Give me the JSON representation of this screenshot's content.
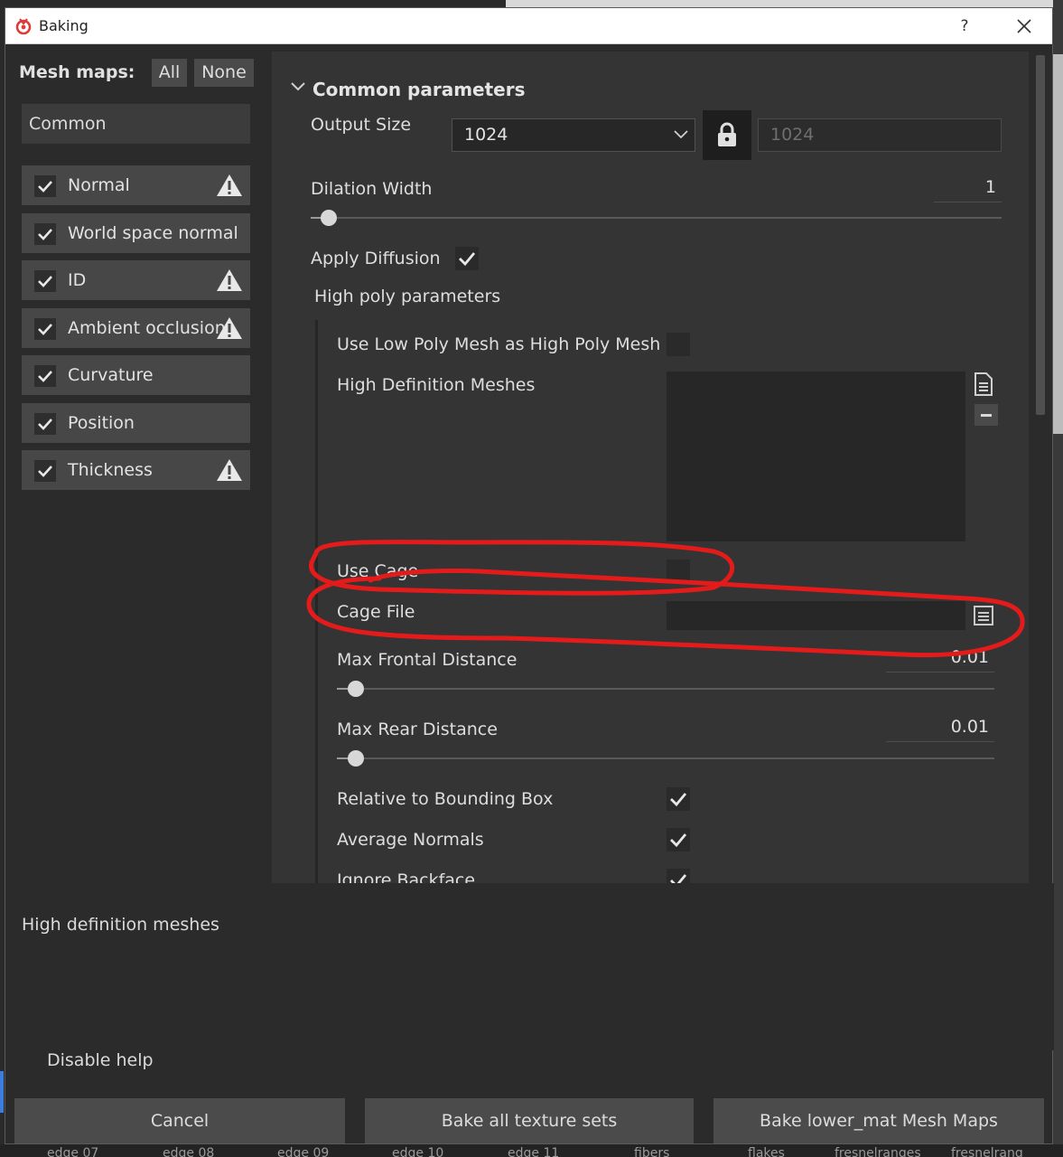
{
  "window": {
    "title": "Baking",
    "help_label": "?"
  },
  "left_panel": {
    "heading": "Mesh maps:",
    "all_label": "All",
    "none_label": "None",
    "common_label": "Common",
    "items": [
      {
        "label": "Normal",
        "checked": true,
        "warning": true
      },
      {
        "label": "World space normal",
        "checked": true,
        "warning": false
      },
      {
        "label": "ID",
        "checked": true,
        "warning": true
      },
      {
        "label": "Ambient occlusion",
        "checked": true,
        "warning": true
      },
      {
        "label": "Curvature",
        "checked": true,
        "warning": false
      },
      {
        "label": "Position",
        "checked": true,
        "warning": false
      },
      {
        "label": "Thickness",
        "checked": true,
        "warning": true
      }
    ]
  },
  "common_parameters": {
    "title": "Common parameters",
    "output_size_label": "Output Size",
    "output_size_value": "1024",
    "output_size_linked_value": "1024",
    "dilation_width_label": "Dilation Width",
    "dilation_width_value": "1",
    "apply_diffusion_label": "Apply Diffusion",
    "apply_diffusion_checked": true
  },
  "high_poly": {
    "title": "High poly parameters",
    "use_low_poly_label": "Use Low Poly Mesh as High Poly Mesh",
    "use_low_poly_checked": false,
    "hd_meshes_label": "High Definition Meshes",
    "use_cage_label": "Use Cage",
    "use_cage_checked": false,
    "cage_file_label": "Cage File",
    "max_frontal_label": "Max Frontal Distance",
    "max_frontal_value": "0.01",
    "max_rear_label": "Max Rear Distance",
    "max_rear_value": "0.01",
    "relative_bbox_label": "Relative to Bounding Box",
    "relative_bbox_checked": true,
    "average_normals_label": "Average Normals",
    "average_normals_checked": true,
    "ignore_backface_label": "Ignore Backface",
    "ignore_backface_checked": true
  },
  "help": {
    "text": "High definition meshes",
    "disable_label": "Disable help"
  },
  "buttons": {
    "cancel": "Cancel",
    "bake_all": "Bake all texture sets",
    "bake_lower": "Bake lower_mat Mesh Maps"
  },
  "background_labels": [
    "edge 07",
    "edge 08",
    "edge 09",
    "edge 10",
    "edge 11",
    "fibers",
    "flakes",
    "fresnelranges",
    "fresnelrang"
  ],
  "colors": {
    "annotation": "#e31b1b",
    "brand": "#e03b3b",
    "panel": "#343434"
  }
}
